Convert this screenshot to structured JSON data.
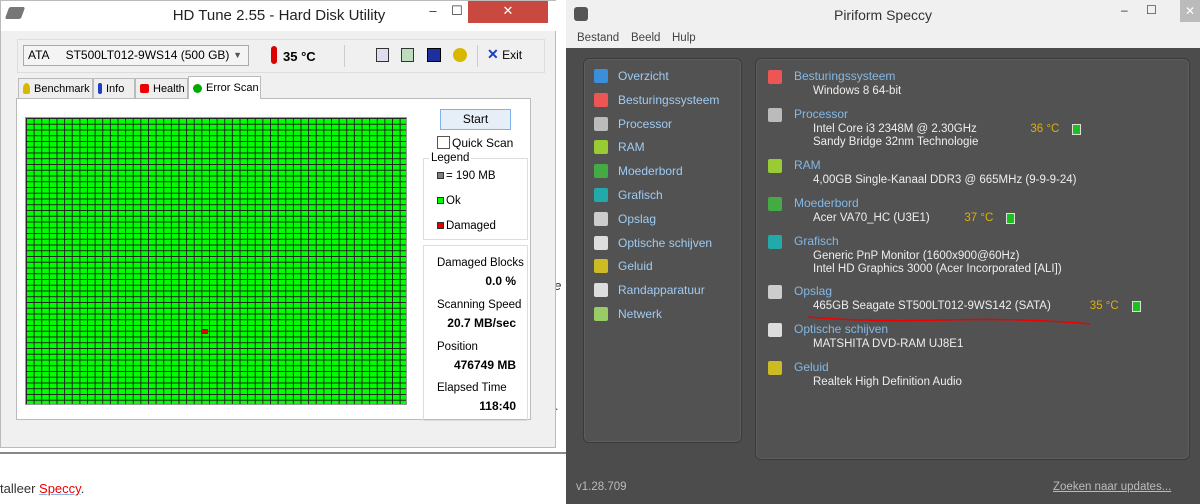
{
  "background_doc": {
    "fragment1": "die",
    "fragment2": "n .",
    "text_prefix": "talleer ",
    "link": "Speccy",
    "suffix": "."
  },
  "hdtune": {
    "title": "HD Tune 2.55 - Hard Disk Utility",
    "drive": "ATA     ST500LT012-9WS14 (500 GB)",
    "temperature": "35 °C",
    "exit_label": "Exit",
    "tabs": [
      {
        "label": "Benchmark"
      },
      {
        "label": "Info"
      },
      {
        "label": "Health"
      },
      {
        "label": "Error Scan"
      }
    ],
    "start_label": "Start",
    "quick_scan_label": "Quick Scan",
    "quick_scan_checked": false,
    "legend": {
      "title": "Legend",
      "block": "= 190 MB",
      "ok": "Ok",
      "damaged": "Damaged"
    },
    "colors": {
      "ok": "#00ff00",
      "damaged": "#e00000",
      "block": "#808080"
    },
    "scan_grid": {
      "columns": 50,
      "rows": 50,
      "damaged_cells": [
        {
          "col": 23,
          "row": 37
        }
      ]
    },
    "stats": [
      {
        "label": "Damaged Blocks",
        "value": "0.0 %"
      },
      {
        "label": "Scanning Speed",
        "value": "20.7 MB/sec"
      },
      {
        "label": "Position",
        "value": "476749 MB"
      },
      {
        "label": "Elapsed Time",
        "value": "118:40"
      }
    ]
  },
  "speccy": {
    "title": "Piriform Speccy",
    "menu": [
      "Bestand",
      "Beeld",
      "Hulp"
    ],
    "sidebar": [
      "Overzicht",
      "Besturingssysteem",
      "Processor",
      "RAM",
      "Moederbord",
      "Grafisch",
      "Opslag",
      "Optische schijven",
      "Geluid",
      "Randapparatuur",
      "Netwerk"
    ],
    "sections": [
      {
        "title": "Besturingssysteem",
        "lines": [
          "Windows 8 64-bit"
        ]
      },
      {
        "title": "Processor",
        "lines": [
          "Intel Core i3 2348M @ 2.30GHz",
          "Sandy Bridge 32nm Technologie"
        ],
        "temp": "36 °C"
      },
      {
        "title": "RAM",
        "lines": [
          "4,00GB Single-Kanaal DDR3 @ 665MHz (9-9-9-24)"
        ]
      },
      {
        "title": "Moederbord",
        "lines": [
          "Acer VA70_HC (U3E1)"
        ],
        "temp": "37 °C"
      },
      {
        "title": "Grafisch",
        "lines": [
          "Generic PnP Monitor (1600x900@60Hz)",
          "Intel HD Graphics 3000 (Acer Incorporated [ALI])"
        ]
      },
      {
        "title": "Opslag",
        "lines": [
          "465GB Seagate ST500LT012-9WS142 (SATA)"
        ],
        "temp": "35 °C"
      },
      {
        "title": "Optische schijven",
        "lines": [
          "MATSHITA DVD-RAM UJ8E1"
        ]
      },
      {
        "title": "Geluid",
        "lines": [
          "Realtek High Definition Audio"
        ]
      }
    ],
    "version": "v1.28.709",
    "update_link": "Zoeken naar updates..."
  }
}
